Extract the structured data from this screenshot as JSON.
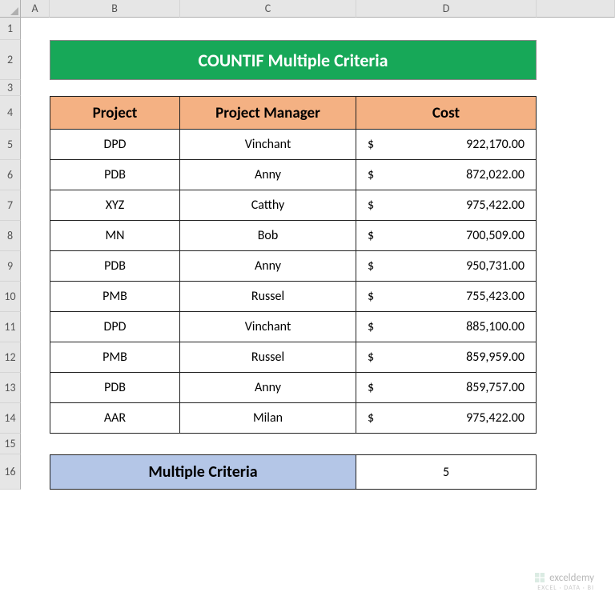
{
  "columns": [
    "A",
    "B",
    "C",
    "D"
  ],
  "title": "COUNTIF Multiple Criteria",
  "headers": {
    "project": "Project",
    "manager": "Project Manager",
    "cost": "Cost"
  },
  "rows": [
    {
      "n": "5",
      "project": "DPD",
      "manager": "Vinchant",
      "cost": "922,170.00"
    },
    {
      "n": "6",
      "project": "PDB",
      "manager": "Anny",
      "cost": "872,022.00"
    },
    {
      "n": "7",
      "project": "XYZ",
      "manager": "Catthy",
      "cost": "975,422.00"
    },
    {
      "n": "8",
      "project": "MN",
      "manager": "Bob",
      "cost": "700,509.00"
    },
    {
      "n": "9",
      "project": "PDB",
      "manager": "Anny",
      "cost": "950,731.00"
    },
    {
      "n": "10",
      "project": "PMB",
      "manager": "Russel",
      "cost": "755,423.00"
    },
    {
      "n": "11",
      "project": "DPD",
      "manager": "Vinchant",
      "cost": "885,100.00"
    },
    {
      "n": "12",
      "project": "PMB",
      "manager": "Russel",
      "cost": "859,959.00"
    },
    {
      "n": "13",
      "project": "PDB",
      "manager": "Anny",
      "cost": "859,757.00"
    },
    {
      "n": "14",
      "project": "AAR",
      "manager": "Milan",
      "cost": "975,422.00"
    }
  ],
  "row_labels_extra": [
    "15",
    "16"
  ],
  "currency_symbol": "$",
  "result_label": "Multiple Criteria",
  "result_value": "5",
  "watermark": {
    "name": "exceldemy",
    "sub": "EXCEL · DATA · BI"
  },
  "chart_data": {
    "type": "table",
    "title": "COUNTIF Multiple Criteria",
    "columns": [
      "Project",
      "Project Manager",
      "Cost"
    ],
    "data": [
      [
        "DPD",
        "Vinchant",
        922170.0
      ],
      [
        "PDB",
        "Anny",
        872022.0
      ],
      [
        "XYZ",
        "Catthy",
        975422.0
      ],
      [
        "MN",
        "Bob",
        700509.0
      ],
      [
        "PDB",
        "Anny",
        950731.0
      ],
      [
        "PMB",
        "Russel",
        755423.0
      ],
      [
        "DPD",
        "Vinchant",
        885100.0
      ],
      [
        "PMB",
        "Russel",
        859959.0
      ],
      [
        "PDB",
        "Anny",
        859757.0
      ],
      [
        "AAR",
        "Milan",
        975422.0
      ]
    ],
    "summary": {
      "label": "Multiple Criteria",
      "value": 5
    }
  }
}
